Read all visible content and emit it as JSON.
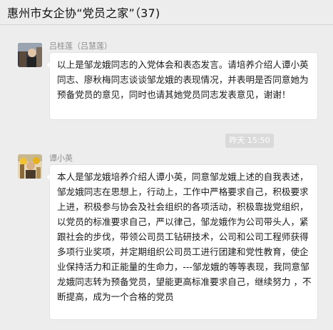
{
  "header": {
    "title": "惠州市女企协“党员之家”（37)"
  },
  "messages": [
    {
      "sender": "吕桂莲（吕慧莲）",
      "avatar": "photo-avatar",
      "text": "以上是邹龙娥同志的入党体会和表态发言。请培养介绍人谭小英同志、廖秋梅同志谈谈邹龙娥的表现情况，并表明是否同意她为预备党员的意见，同时也请其她党员同志发表意见，谢谢！"
    },
    {
      "sender": "谭小英",
      "avatar": "photo-avatar",
      "text": "本人是邹龙娥培养介绍人谭小英，同意邹龙娥上述的自我表述，邹龙娥同志在思想上，行动上，工作中严格要求自己，积极要求上进，积极参与协会及社会组织的各项活动，积极靠拢党组织，以党员的标准要求自己，严以律己，邹龙娥作为公司带头人，紧跟社会的步伐，带领公司员工钻研技术，公司和公司工程师获得多项行业奖项，并定期组织公司员工进行团建和党性教育，使企业保持活力和正能量的生命力，---邹龙娥的等等表现，我同意邹龙娥同志转为预备党员，望能更高标准要求自己，继续努力 ，不断提高，成为一个合格的党员"
    }
  ],
  "timestamp": "昨天 15:50"
}
